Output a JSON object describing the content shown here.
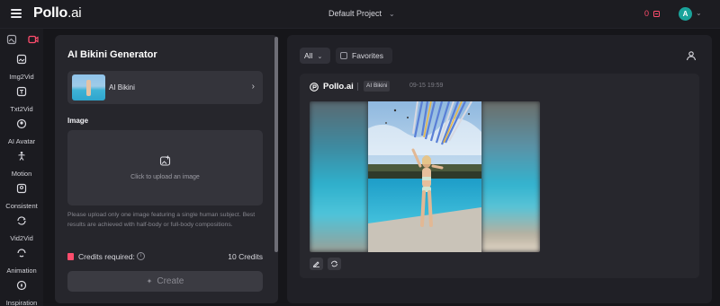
{
  "topbar": {
    "brand": "Pollo",
    "brand_suffix": ".ai",
    "project_name": "Default Project",
    "credits": "0",
    "avatar_initial": "A"
  },
  "sidebar": {
    "items": [
      {
        "label": "Img2Vid",
        "icon": "image-video-icon"
      },
      {
        "label": "Txt2Vid",
        "icon": "text-video-icon"
      },
      {
        "label": "AI Avatar",
        "icon": "avatar-icon"
      },
      {
        "label": "Motion",
        "icon": "motion-icon"
      },
      {
        "label": "Consistent",
        "icon": "consistent-icon"
      },
      {
        "label": "Vid2Vid",
        "icon": "video-video-icon"
      },
      {
        "label": "Animation",
        "icon": "animation-icon"
      },
      {
        "label": "Inspiration",
        "icon": "compass-icon"
      }
    ]
  },
  "generator": {
    "title": "AI Bikini Generator",
    "model_name": "AI Bikini",
    "image_section_label": "Image",
    "upload_prompt": "Click to upload an image",
    "hint": "Please upload only one image featuring a single human subject. Best results are achieved with half-body or full-body compositions.",
    "credits_label": "Credits required:",
    "credits_value": "10 Credits",
    "create_label": "Create"
  },
  "results": {
    "filter_value": "All",
    "favorites_label": "Favorites",
    "card": {
      "brand": "Pollo.ai",
      "tag": "AI Bikini",
      "timestamp": "09-15 19:59"
    }
  },
  "colors": {
    "accent_red": "#ff4d6d",
    "avatar_teal": "#1aa39b",
    "background": "#16161a",
    "panel": "#26262c"
  }
}
